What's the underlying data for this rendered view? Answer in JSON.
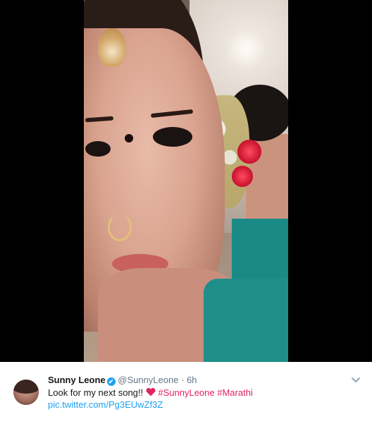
{
  "tweet": {
    "author_name": "Sunny Leone",
    "verified_glyph": "✔",
    "handle": "@SunnyLeone",
    "separator": "·",
    "time": "6h",
    "text_prefix": "Look for my next song!!",
    "heart_icon": "heart-icon",
    "hashtags": [
      "#SunnyLeone",
      "#Marathi"
    ],
    "link": "pic.twitter.com/Pg3EUwZf3Z",
    "menu_icon": "chevron-down-icon"
  },
  "colors": {
    "link_blue": "#1da1f2",
    "hashtag_color": "#e0245e",
    "heart_red": "#e0245e",
    "muted_gray": "#657786"
  }
}
